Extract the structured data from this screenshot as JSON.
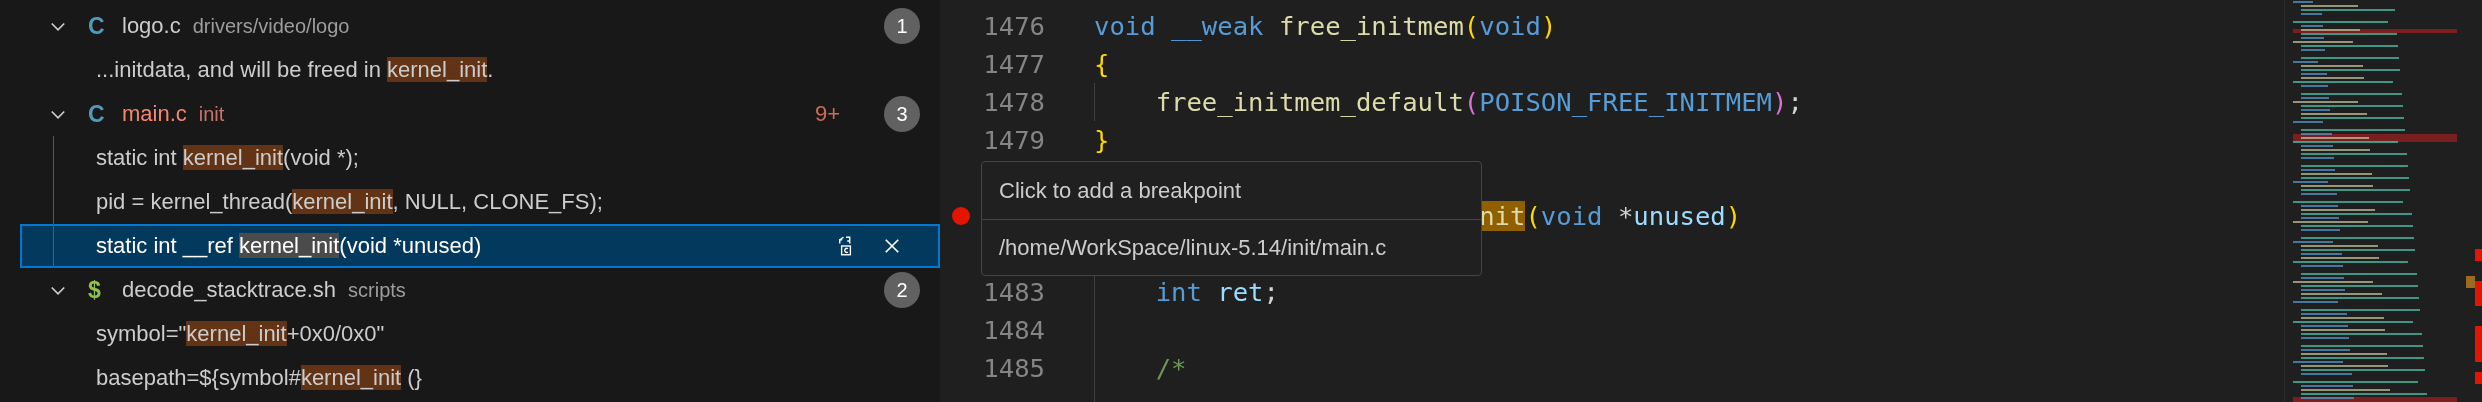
{
  "search_results": [
    {
      "icon": "C",
      "color": "#519aba",
      "file": "logo.c",
      "path": "drivers/video/logo",
      "has_errors": false,
      "count": "1",
      "expanded": true,
      "matches": [
        {
          "selected": false,
          "parts": [
            {
              "text": "...initdata, and will be freed in ",
              "match": false
            },
            {
              "text": "kernel_init",
              "match": true
            },
            {
              "text": ".",
              "match": false
            }
          ]
        }
      ]
    },
    {
      "icon": "C",
      "color": "#519aba",
      "file": "main.c",
      "path": "init",
      "has_errors": true,
      "problems": "9+",
      "count": "3",
      "expanded": true,
      "matches": [
        {
          "selected": false,
          "parts": [
            {
              "text": "static int ",
              "match": false
            },
            {
              "text": "kernel_init",
              "match": true
            },
            {
              "text": "(void *);",
              "match": false
            }
          ]
        },
        {
          "selected": false,
          "parts": [
            {
              "text": "pid = kernel_thread(",
              "match": false
            },
            {
              "text": "kernel_init",
              "match": true
            },
            {
              "text": ", NULL, CLONE_FS);",
              "match": false
            }
          ]
        },
        {
          "selected": true,
          "parts": [
            {
              "text": "static int __ref ",
              "match": false
            },
            {
              "text": "kernel_init",
              "match": true
            },
            {
              "text": "(void *unused)",
              "match": false
            }
          ]
        }
      ]
    },
    {
      "icon": "$",
      "color": "#8dc149",
      "file": "decode_stacktrace.sh",
      "path": "scripts",
      "has_errors": false,
      "count": "2",
      "expanded": true,
      "matches": [
        {
          "selected": false,
          "parts": [
            {
              "text": "symbol=\"",
              "match": false
            },
            {
              "text": "kernel_init",
              "match": true
            },
            {
              "text": "+0x0/0x0\"",
              "match": false
            }
          ]
        },
        {
          "selected": false,
          "parts": [
            {
              "text": "basepath=${symbol#",
              "match": false
            },
            {
              "text": "kernel_init",
              "match": true
            },
            {
              "text": " (}",
              "match": false
            }
          ]
        }
      ]
    }
  ],
  "editor": {
    "lines": [
      {
        "number": "1476",
        "breakpoint_hint": false,
        "covered": false,
        "indented": false,
        "tokens": [
          {
            "text": "void ",
            "kind": "keyword"
          },
          {
            "text": "__weak ",
            "kind": "keyword"
          },
          {
            "text": "free_initmem",
            "kind": "function"
          },
          {
            "text": "(",
            "kind": "bracket1"
          },
          {
            "text": "void",
            "kind": "keyword"
          },
          {
            "text": ")",
            "kind": "bracket1"
          }
        ]
      },
      {
        "number": "1477",
        "breakpoint_hint": false,
        "covered": false,
        "indented": false,
        "tokens": [
          {
            "text": "{",
            "kind": "bracket1"
          }
        ]
      },
      {
        "number": "1478",
        "breakpoint_hint": false,
        "covered": false,
        "indented": true,
        "tokens": [
          {
            "text": "free_initmem_default",
            "kind": "function"
          },
          {
            "text": "(",
            "kind": "bracket2"
          },
          {
            "text": "POISON_FREE_INITMEM",
            "kind": "macro"
          },
          {
            "text": ")",
            "kind": "bracket2"
          },
          {
            "text": ";",
            "kind": "plain"
          }
        ]
      },
      {
        "number": "1479",
        "breakpoint_hint": false,
        "covered": false,
        "indented": false,
        "tokens": [
          {
            "text": "}",
            "kind": "bracket1"
          }
        ]
      },
      {
        "breakpoint_hint": false
      },
      {
        "breakpoint_hint": true,
        "covered": true,
        "indented": false,
        "tokens": [
          {
            "text": "nit",
            "kind": "function",
            "match": true
          },
          {
            "text": "(",
            "kind": "bracket1"
          },
          {
            "text": "void",
            "kind": "keyword"
          },
          {
            "text": " *",
            "kind": "plain"
          },
          {
            "text": "unused",
            "kind": "variable"
          },
          {
            "text": ")",
            "kind": "bracket1"
          }
        ]
      },
      {
        "breakpoint_hint": false
      },
      {
        "number": "1483",
        "breakpoint_hint": false,
        "covered": false,
        "indented": true,
        "tokens": [
          {
            "text": "int ",
            "kind": "keyword"
          },
          {
            "text": "ret",
            "kind": "variable"
          },
          {
            "text": ";",
            "kind": "plain"
          }
        ]
      },
      {
        "number": "1484",
        "breakpoint_hint": false,
        "covered": false,
        "indented": true
      },
      {
        "number": "1485",
        "breakpoint_hint": false,
        "covered": false,
        "indented": true,
        "tokens": [
          {
            "text": "/*",
            "kind": "comment"
          }
        ]
      },
      {
        "breakpoint_hint": false,
        "covered": false,
        "indented": true
      }
    ]
  },
  "tooltip": {
    "title": "Click to add a breakpoint",
    "path": "/home/WorkSpace/linux-5.14/init/main.c"
  }
}
